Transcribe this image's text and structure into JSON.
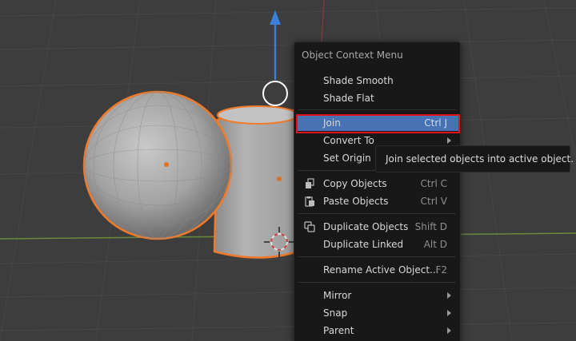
{
  "context_menu": {
    "title": "Object Context Menu",
    "items": [
      {
        "label": "Shade Smooth",
        "shortcut": "",
        "submenu": false
      },
      {
        "label": "Shade Flat",
        "shortcut": "",
        "submenu": false
      },
      {
        "label": "Join",
        "shortcut": "Ctrl J",
        "submenu": false,
        "active": true
      },
      {
        "label": "Convert To",
        "shortcut": "",
        "submenu": true
      },
      {
        "label": "Set Origin",
        "shortcut": "",
        "submenu": true
      },
      {
        "label": "Copy Objects",
        "shortcut": "Ctrl C",
        "icon": "copy-icon"
      },
      {
        "label": "Paste Objects",
        "shortcut": "Ctrl V",
        "icon": "paste-icon"
      },
      {
        "label": "Duplicate Objects",
        "shortcut": "Shift D",
        "icon": "duplicate-icon"
      },
      {
        "label": "Duplicate Linked",
        "shortcut": "Alt D"
      },
      {
        "label": "Rename Active Object...",
        "shortcut": "F2"
      },
      {
        "label": "Mirror",
        "shortcut": "",
        "submenu": true
      },
      {
        "label": "Snap",
        "shortcut": "",
        "submenu": true
      },
      {
        "label": "Parent",
        "shortcut": "",
        "submenu": true
      }
    ]
  },
  "tooltip": {
    "text": "Join selected objects into active object."
  },
  "colors": {
    "highlight": "#4772b3",
    "outline": "#e2121b",
    "selection": "#f07a2a",
    "gizmo": "#3a7fd9"
  }
}
